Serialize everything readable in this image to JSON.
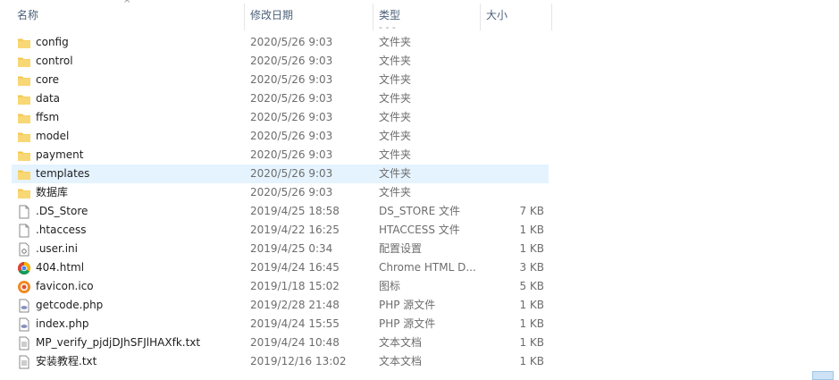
{
  "columns": {
    "name": "名称",
    "date": "修改日期",
    "type": "类型",
    "size": "大小"
  },
  "files": [
    {
      "name": "config",
      "date": "2020/5/26 9:03",
      "type": "文件夹",
      "size": "",
      "icon": "folder-icon"
    },
    {
      "name": "control",
      "date": "2020/5/26 9:03",
      "type": "文件夹",
      "size": "",
      "icon": "folder-icon"
    },
    {
      "name": "core",
      "date": "2020/5/26 9:03",
      "type": "文件夹",
      "size": "",
      "icon": "folder-icon"
    },
    {
      "name": "data",
      "date": "2020/5/26 9:03",
      "type": "文件夹",
      "size": "",
      "icon": "folder-icon"
    },
    {
      "name": "ffsm",
      "date": "2020/5/26 9:03",
      "type": "文件夹",
      "size": "",
      "icon": "folder-icon"
    },
    {
      "name": "model",
      "date": "2020/5/26 9:03",
      "type": "文件夹",
      "size": "",
      "icon": "folder-icon"
    },
    {
      "name": "payment",
      "date": "2020/5/26 9:03",
      "type": "文件夹",
      "size": "",
      "icon": "folder-icon"
    },
    {
      "name": "templates",
      "date": "2020/5/26 9:03",
      "type": "文件夹",
      "size": "",
      "icon": "folder-icon",
      "selected": true
    },
    {
      "name": "数据库",
      "date": "2020/5/26 9:03",
      "type": "文件夹",
      "size": "",
      "icon": "folder-icon"
    },
    {
      "name": ".DS_Store",
      "date": "2019/4/25 18:58",
      "type": "DS_STORE 文件",
      "size": "7 KB",
      "icon": "file-icon"
    },
    {
      "name": ".htaccess",
      "date": "2019/4/22 16:25",
      "type": "HTACCESS 文件",
      "size": "1 KB",
      "icon": "file-icon"
    },
    {
      "name": ".user.ini",
      "date": "2019/4/25 0:34",
      "type": "配置设置",
      "size": "1 KB",
      "icon": "settings-file-icon"
    },
    {
      "name": "404.html",
      "date": "2019/4/24 16:45",
      "type": "Chrome HTML D...",
      "size": "3 KB",
      "icon": "chrome-icon"
    },
    {
      "name": "favicon.ico",
      "date": "2019/1/18 15:02",
      "type": "图标",
      "size": "5 KB",
      "icon": "image-icon"
    },
    {
      "name": "getcode.php",
      "date": "2019/2/28 21:48",
      "type": "PHP 源文件",
      "size": "1 KB",
      "icon": "php-file-icon"
    },
    {
      "name": "index.php",
      "date": "2019/4/24 15:55",
      "type": "PHP 源文件",
      "size": "1 KB",
      "icon": "php-file-icon"
    },
    {
      "name": "MP_verify_pjdjDJhSFJlHAXfk.txt",
      "date": "2019/4/24 10:48",
      "type": "文本文档",
      "size": "1 KB",
      "icon": "text-file-icon"
    },
    {
      "name": "安装教程.txt",
      "date": "2019/12/16 13:02",
      "type": "文本文档",
      "size": "1 KB",
      "icon": "text-file-icon"
    }
  ],
  "colors": {
    "selected_row": "#e5f3ff",
    "folder": "#f3c74c",
    "header_text": "#4c607a"
  }
}
